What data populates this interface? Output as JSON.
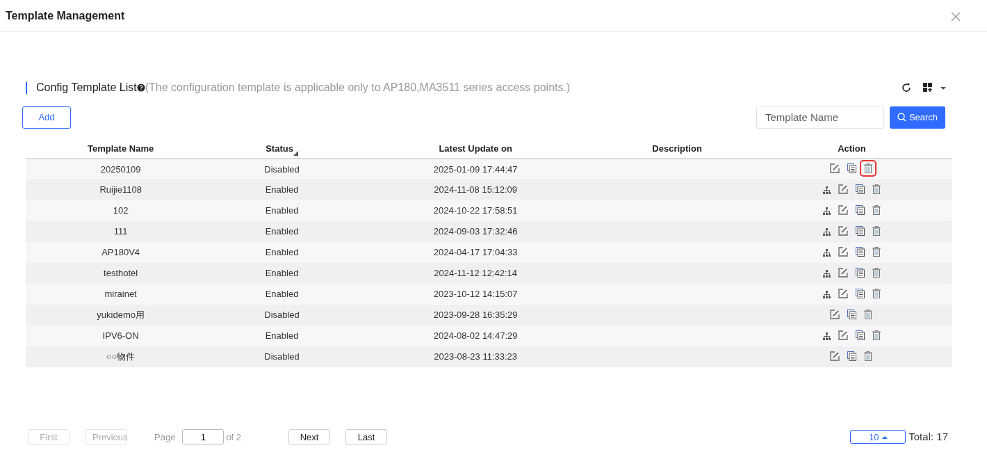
{
  "window": {
    "title": "Template Management"
  },
  "section": {
    "title": "Config Template List",
    "note": "(The configuration template is applicable only to AP180,MA3511 series access points.)"
  },
  "toolbar": {
    "add_label": "Add",
    "search": {
      "placeholder": "Template Name"
    },
    "search_label": "Search"
  },
  "table": {
    "columns": [
      {
        "label": "Template Name",
        "sorted": false
      },
      {
        "label": "Status",
        "sorted": true
      },
      {
        "label": "Latest Update on",
        "sorted": false
      },
      {
        "label": "Description",
        "sorted": false
      },
      {
        "label": "Action",
        "sorted": false
      }
    ],
    "rows": [
      {
        "name": "20250109",
        "status": "Disabled",
        "updated": "2025-01-09 17:44:47",
        "actions": [
          {
            "kind": "edit",
            "highlighted": false
          },
          {
            "kind": "copy",
            "highlighted": false
          },
          {
            "kind": "delete",
            "highlighted": true
          }
        ]
      },
      {
        "name": "Ruijie1108",
        "status": "Enabled",
        "updated": "2024-11-08 15:12:09",
        "actions": [
          {
            "kind": "topology",
            "highlighted": false
          },
          {
            "kind": "edit",
            "highlighted": false
          },
          {
            "kind": "copy",
            "highlighted": false
          },
          {
            "kind": "delete",
            "highlighted": false
          }
        ]
      },
      {
        "name": "102",
        "status": "Enabled",
        "updated": "2024-10-22 17:58:51",
        "actions": [
          {
            "kind": "topology",
            "highlighted": false
          },
          {
            "kind": "edit",
            "highlighted": false
          },
          {
            "kind": "copy",
            "highlighted": false
          },
          {
            "kind": "delete",
            "highlighted": false
          }
        ]
      },
      {
        "name": "111",
        "status": "Enabled",
        "updated": "2024-09-03 17:32:46",
        "actions": [
          {
            "kind": "topology",
            "highlighted": false
          },
          {
            "kind": "edit",
            "highlighted": false
          },
          {
            "kind": "copy",
            "highlighted": false
          },
          {
            "kind": "delete",
            "highlighted": false
          }
        ]
      },
      {
        "name": "AP180V4",
        "status": "Enabled",
        "updated": "2024-04-17 17:04:33",
        "actions": [
          {
            "kind": "topology",
            "highlighted": false
          },
          {
            "kind": "edit",
            "highlighted": false
          },
          {
            "kind": "copy",
            "highlighted": false
          },
          {
            "kind": "delete",
            "highlighted": false
          }
        ]
      },
      {
        "name": "testhotel",
        "status": "Enabled",
        "updated": "2024-11-12 12:42:14",
        "actions": [
          {
            "kind": "topology",
            "highlighted": false
          },
          {
            "kind": "edit",
            "highlighted": false
          },
          {
            "kind": "copy",
            "highlighted": false
          },
          {
            "kind": "delete",
            "highlighted": false
          }
        ]
      },
      {
        "name": "mirainet",
        "status": "Enabled",
        "updated": "2023-10-12 14:15:07",
        "actions": [
          {
            "kind": "topology",
            "highlighted": false
          },
          {
            "kind": "edit",
            "highlighted": false
          },
          {
            "kind": "copy",
            "highlighted": false
          },
          {
            "kind": "delete",
            "highlighted": false
          }
        ]
      },
      {
        "name": "yukidemo用",
        "status": "Disabled",
        "updated": "2023-09-28 16:35:29",
        "actions": [
          {
            "kind": "edit",
            "highlighted": false
          },
          {
            "kind": "copy",
            "highlighted": false
          },
          {
            "kind": "delete",
            "highlighted": false
          }
        ]
      },
      {
        "name": "IPV6-ON",
        "status": "Enabled",
        "updated": "2024-08-02 14:47:29",
        "actions": [
          {
            "kind": "topology",
            "highlighted": false
          },
          {
            "kind": "edit",
            "highlighted": false
          },
          {
            "kind": "copy",
            "highlighted": false
          },
          {
            "kind": "delete",
            "highlighted": false
          }
        ]
      },
      {
        "name": "○○物件",
        "status": "Disabled",
        "updated": "2023-08-23 11:33:23",
        "actions": [
          {
            "kind": "edit",
            "highlighted": false
          },
          {
            "kind": "copy",
            "highlighted": false
          },
          {
            "kind": "delete",
            "highlighted": false
          }
        ]
      }
    ]
  },
  "pagination": {
    "buttons": [
      {
        "label": "First",
        "disabled": true
      },
      {
        "label": "Previous",
        "disabled": true
      }
    ],
    "page_label": "Page",
    "page_value": "1",
    "of_label": "of 2",
    "buttons_after": [
      {
        "label": "Next",
        "disabled": false
      },
      {
        "label": "Last",
        "disabled": false
      }
    ],
    "page_size": "10",
    "total": "Total: 17"
  }
}
